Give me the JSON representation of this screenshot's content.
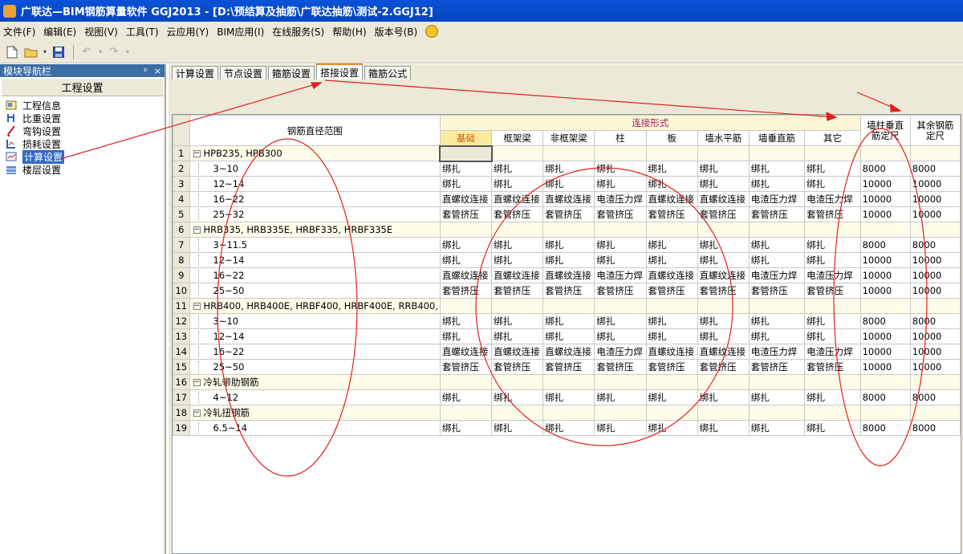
{
  "window": {
    "title": "广联达—BIM钢筋算量软件 GGJ2013 - [D:\\预结算及抽筋\\广联达抽筋\\测试-2.GGJ12]"
  },
  "menu": [
    "文件(F)",
    "编辑(E)",
    "视图(V)",
    "工具(T)",
    "云应用(Y)",
    "BIM应用(I)",
    "在线服务(S)",
    "帮助(H)",
    "版本号(B)"
  ],
  "toolbar": {
    "icons": [
      "new-icon",
      "open-icon",
      "save-icon",
      "undo-icon",
      "redo-icon"
    ]
  },
  "left_panel": {
    "header": "模块导航栏",
    "header_controls": [
      "ᵖ",
      "×"
    ],
    "section": "工程设置",
    "items": [
      {
        "label": "工程信息",
        "icon": "info-icon"
      },
      {
        "label": "比重设置",
        "icon": "weight-icon"
      },
      {
        "label": "弯钩设置",
        "icon": "hook-icon"
      },
      {
        "label": "损耗设置",
        "icon": "loss-icon"
      },
      {
        "label": "计算设置",
        "icon": "calc-icon",
        "selected": true
      },
      {
        "label": "楼层设置",
        "icon": "floor-icon"
      }
    ]
  },
  "tabs": [
    {
      "label": "计算设置",
      "active": false
    },
    {
      "label": "节点设置",
      "active": false
    },
    {
      "label": "箍筋设置",
      "active": false
    },
    {
      "label": "搭接设置",
      "active": true
    },
    {
      "label": "箍筋公式",
      "active": false
    }
  ],
  "grid": {
    "col_range": "钢筋直径范围",
    "col_connect": "连接形式",
    "connect_subcols": [
      "基础",
      "框架梁",
      "非框架梁",
      "柱",
      "板",
      "墙水平筋",
      "墙垂直筋",
      "其它"
    ],
    "col_wall_len": "墙柱垂直筋定尺",
    "col_other_len": "其余钢筋定尺",
    "rows": [
      {
        "n": "1",
        "group": true,
        "label": "HPB235, HPB300",
        "v": [
          "",
          "",
          "",
          "",
          "",
          "",
          "",
          ""
        ],
        "a": "",
        "b": ""
      },
      {
        "n": "2",
        "label": "3~10",
        "v": [
          "绑扎",
          "绑扎",
          "绑扎",
          "绑扎",
          "绑扎",
          "绑扎",
          "绑扎",
          "绑扎"
        ],
        "a": "8000",
        "b": "8000"
      },
      {
        "n": "3",
        "label": "12~14",
        "v": [
          "绑扎",
          "绑扎",
          "绑扎",
          "绑扎",
          "绑扎",
          "绑扎",
          "绑扎",
          "绑扎"
        ],
        "a": "10000",
        "b": "10000"
      },
      {
        "n": "4",
        "label": "16~22",
        "v": [
          "直螺纹连接",
          "直螺纹连接",
          "直螺纹连接",
          "电渣压力焊",
          "直螺纹连接",
          "直螺纹连接",
          "电渣压力焊",
          "电渣压力焊"
        ],
        "a": "10000",
        "b": "10000"
      },
      {
        "n": "5",
        "label": "25~32",
        "v": [
          "套管挤压",
          "套管挤压",
          "套管挤压",
          "套管挤压",
          "套管挤压",
          "套管挤压",
          "套管挤压",
          "套管挤压"
        ],
        "a": "10000",
        "b": "10000"
      },
      {
        "n": "6",
        "group": true,
        "label": "HRB335, HRB335E, HRBF335, HRBF335E",
        "v": [
          "",
          "",
          "",
          "",
          "",
          "",
          "",
          ""
        ],
        "a": "",
        "b": ""
      },
      {
        "n": "7",
        "label": "3~11.5",
        "v": [
          "绑扎",
          "绑扎",
          "绑扎",
          "绑扎",
          "绑扎",
          "绑扎",
          "绑扎",
          "绑扎"
        ],
        "a": "8000",
        "b": "8000"
      },
      {
        "n": "8",
        "label": "12~14",
        "v": [
          "绑扎",
          "绑扎",
          "绑扎",
          "绑扎",
          "绑扎",
          "绑扎",
          "绑扎",
          "绑扎"
        ],
        "a": "10000",
        "b": "10000"
      },
      {
        "n": "9",
        "label": "16~22",
        "v": [
          "直螺纹连接",
          "直螺纹连接",
          "直螺纹连接",
          "电渣压力焊",
          "直螺纹连接",
          "直螺纹连接",
          "电渣压力焊",
          "电渣压力焊"
        ],
        "a": "10000",
        "b": "10000"
      },
      {
        "n": "10",
        "label": "25~50",
        "v": [
          "套管挤压",
          "套管挤压",
          "套管挤压",
          "套管挤压",
          "套管挤压",
          "套管挤压",
          "套管挤压",
          "套管挤压"
        ],
        "a": "10000",
        "b": "10000"
      },
      {
        "n": "11",
        "group": true,
        "label": "HRB400, HRB400E, HRBF400, HRBF400E, RRB400,",
        "v": [
          "",
          "",
          "",
          "",
          "",
          "",
          "",
          ""
        ],
        "a": "",
        "b": ""
      },
      {
        "n": "12",
        "label": "3~10",
        "v": [
          "绑扎",
          "绑扎",
          "绑扎",
          "绑扎",
          "绑扎",
          "绑扎",
          "绑扎",
          "绑扎"
        ],
        "a": "8000",
        "b": "8000"
      },
      {
        "n": "13",
        "label": "12~14",
        "v": [
          "绑扎",
          "绑扎",
          "绑扎",
          "绑扎",
          "绑扎",
          "绑扎",
          "绑扎",
          "绑扎"
        ],
        "a": "10000",
        "b": "10000"
      },
      {
        "n": "14",
        "label": "16~22",
        "v": [
          "直螺纹连接",
          "直螺纹连接",
          "直螺纹连接",
          "电渣压力焊",
          "直螺纹连接",
          "直螺纹连接",
          "电渣压力焊",
          "电渣压力焊"
        ],
        "a": "10000",
        "b": "10000"
      },
      {
        "n": "15",
        "label": "25~50",
        "v": [
          "套管挤压",
          "套管挤压",
          "套管挤压",
          "套管挤压",
          "套管挤压",
          "套管挤压",
          "套管挤压",
          "套管挤压"
        ],
        "a": "10000",
        "b": "10000"
      },
      {
        "n": "16",
        "group": true,
        "label": "冷轧带肋钢筋",
        "v": [
          "",
          "",
          "",
          "",
          "",
          "",
          "",
          ""
        ],
        "a": "",
        "b": ""
      },
      {
        "n": "17",
        "label": "4~12",
        "v": [
          "绑扎",
          "绑扎",
          "绑扎",
          "绑扎",
          "绑扎",
          "绑扎",
          "绑扎",
          "绑扎"
        ],
        "a": "8000",
        "b": "8000"
      },
      {
        "n": "18",
        "group": true,
        "label": "冷轧扭钢筋",
        "v": [
          "",
          "",
          "",
          "",
          "",
          "",
          "",
          ""
        ],
        "a": "",
        "b": ""
      },
      {
        "n": "19",
        "label": "6.5~14",
        "v": [
          "绑扎",
          "绑扎",
          "绑扎",
          "绑扎",
          "绑扎",
          "绑扎",
          "绑扎",
          "绑扎"
        ],
        "a": "8000",
        "b": "8000"
      }
    ]
  },
  "colors": {
    "title_bar": "#0a52d6",
    "annotation": "#e0201c",
    "header_connect_text": "#a0206a",
    "header_first_text": "#d25a00"
  }
}
